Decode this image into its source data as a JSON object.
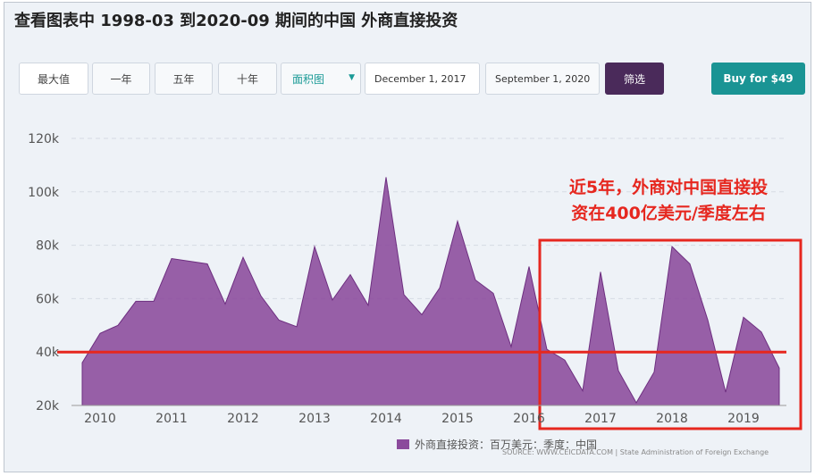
{
  "title": "查看图表中 1998-03 到2020-09 期间的中国 外商直接投资",
  "toolbar": {
    "max": "最大值",
    "one_year": "一年",
    "five_year": "五年",
    "ten_year": "十年",
    "chart_type": "面积图",
    "date_from": "December 1, 2017",
    "date_to": "September 1, 2020",
    "filter": "筛选",
    "buy": "Buy for $49"
  },
  "annotation": [
    "近5年，外商对中国直接投",
    "资在400亿美元/季度左右"
  ],
  "legend_label": "外商直接投资：百万美元：季度：中国",
  "source": "SOURCE: WWW.CEICDATA.COM | State Administration of Foreign Exchange",
  "colors": {
    "area": "#8b4a9c",
    "reference_line": "#e6271f",
    "filter_button": "#4a2a5a",
    "buy_button": "#1a9494"
  },
  "chart_data": {
    "type": "area",
    "title": "",
    "xlabel": "",
    "ylabel": "",
    "ylim": [
      20000,
      120000
    ],
    "yticks": [
      20000,
      40000,
      60000,
      80000,
      100000,
      120000
    ],
    "ytick_labels": [
      "20k",
      "40k",
      "60k",
      "80k",
      "100k",
      "120k"
    ],
    "xlim": [
      2009.6,
      2019.6
    ],
    "xticks": [
      2010,
      2011,
      2012,
      2013,
      2014,
      2015,
      2016,
      2017,
      2018,
      2019
    ],
    "xtick_labels": [
      "2010",
      "2011",
      "2012",
      "2013",
      "2014",
      "2015",
      "2016",
      "2017",
      "2018",
      "2019"
    ],
    "grid": true,
    "legend_position": "bottom",
    "series": [
      {
        "name": "外商直接投资：百万美元：季度：中国",
        "x": [
          2009.75,
          2010.0,
          2010.25,
          2010.5,
          2010.75,
          2011.0,
          2011.25,
          2011.5,
          2011.75,
          2012.0,
          2012.25,
          2012.5,
          2012.75,
          2013.0,
          2013.25,
          2013.5,
          2013.75,
          2014.0,
          2014.25,
          2014.5,
          2014.75,
          2015.0,
          2015.25,
          2015.5,
          2015.75,
          2016.0,
          2016.25,
          2016.5,
          2016.75,
          2017.0,
          2017.25,
          2017.5,
          2017.75,
          2018.0,
          2018.25,
          2018.5,
          2018.75,
          2019.0,
          2019.25,
          2019.5
        ],
        "values": [
          36000,
          47000,
          50000,
          59000,
          59000,
          75000,
          74000,
          73000,
          58000,
          75500,
          61000,
          52000,
          49500,
          79500,
          59500,
          69000,
          57500,
          105500,
          61500,
          54000,
          64000,
          89000,
          67000,
          62000,
          42000,
          72000,
          41000,
          37000,
          25500,
          70000,
          33000,
          21000,
          32500,
          79500,
          73000,
          52000,
          25000,
          53000,
          47500,
          34000
        ]
      }
    ],
    "reference_line": 40000
  }
}
